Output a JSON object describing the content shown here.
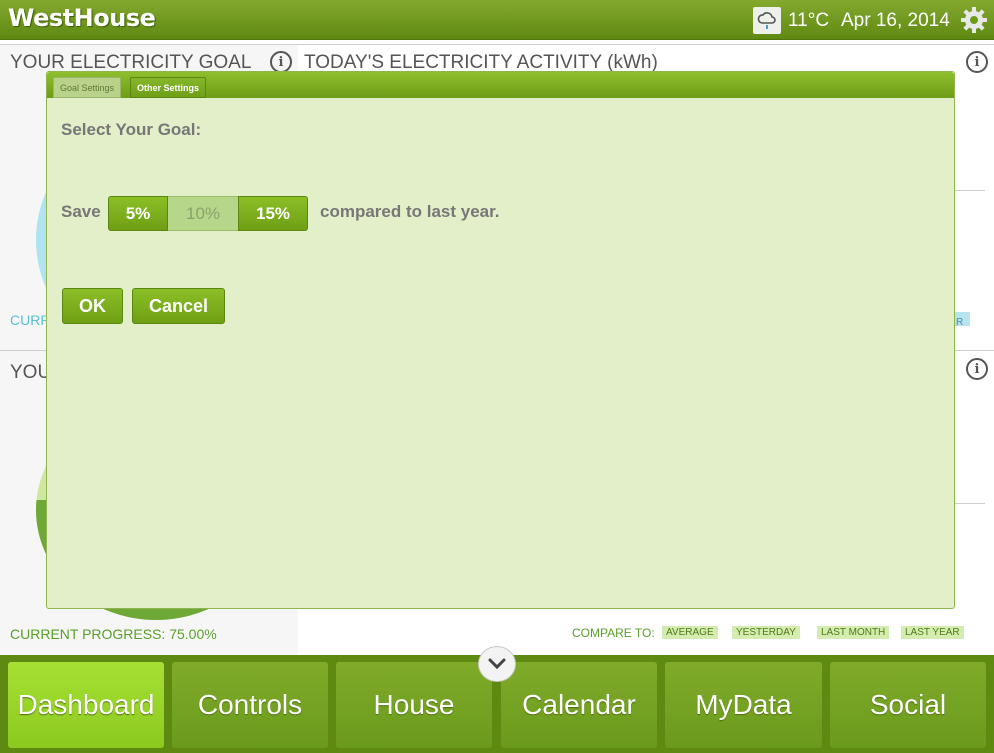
{
  "header": {
    "app_title": "WestHouse",
    "temperature": "11°C",
    "date": "Apr 16, 2014",
    "weather_icon": "cloud-rain-icon",
    "settings_icon": "gear-icon"
  },
  "dashboard": {
    "goal_title": "YOUR ELECTRICITY GOAL",
    "activity_title": "TODAY'S ELECTRICITY ACTIVITY (kWh)",
    "second_left_title": "YOU",
    "current_top_label": "CURR",
    "current_progress": "CURRENT PROGRESS: 75.00%",
    "compare_label": "COMPARE TO:",
    "compare_options": [
      "AVERAGE",
      "YESTERDAY",
      "LAST MONTH",
      "LAST YEAR"
    ],
    "info_glyph": "i",
    "chip_fragment": "R"
  },
  "modal": {
    "tabs": [
      "Goal Settings",
      "Other Settings"
    ],
    "heading": "Select Your Goal:",
    "save_label": "Save",
    "options": [
      "5%",
      "10%",
      "15%"
    ],
    "compared_text": "compared to last year.",
    "ok_label": "OK",
    "cancel_label": "Cancel"
  },
  "nav": {
    "items": [
      "Dashboard",
      "Controls",
      "House",
      "Calendar",
      "MyData",
      "Social"
    ],
    "active": "Dashboard",
    "toggle_icon": "chevron-down-icon"
  },
  "colors": {
    "brand_green": "#6d9c17",
    "active_nav": "#9ad62a",
    "modal_bg": "#e2efc8",
    "progress_text": "#5aa02a",
    "current_text_cyan": "#5bbfd6"
  }
}
